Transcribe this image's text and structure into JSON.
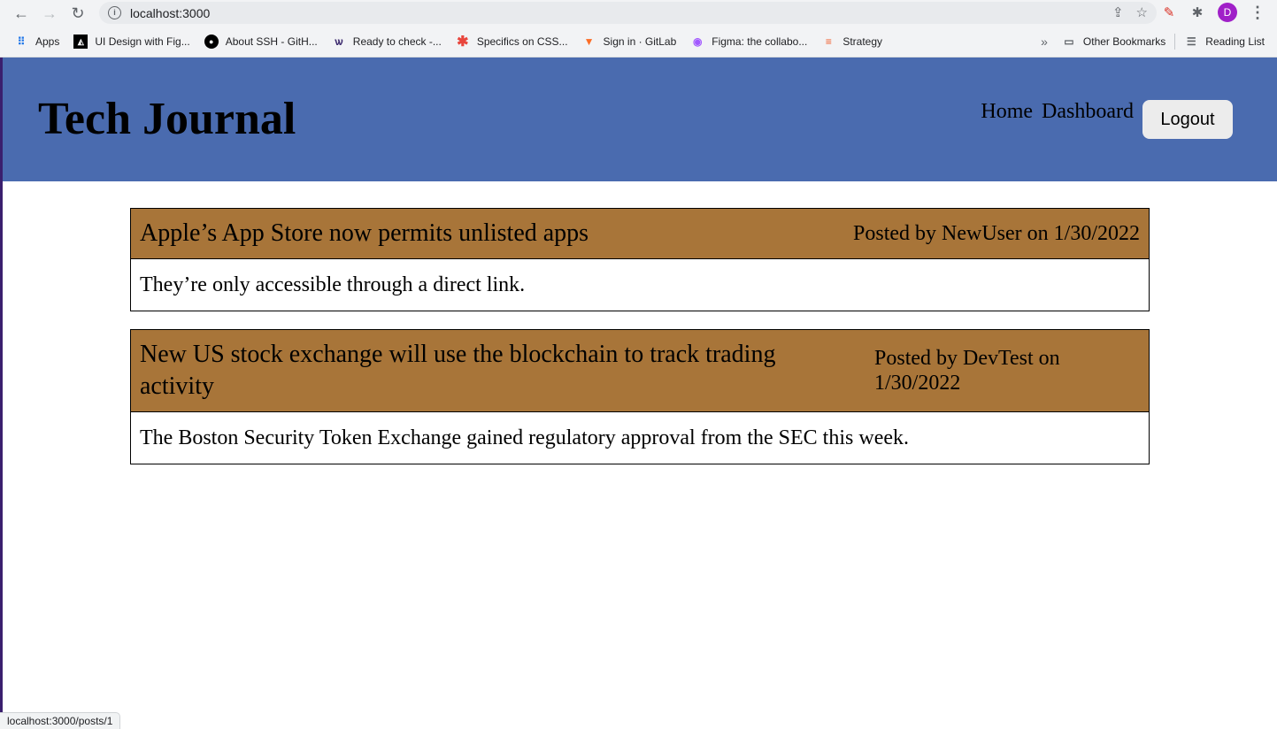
{
  "browser": {
    "url": "localhost:3000",
    "bookmarks": [
      {
        "label": "Apps",
        "icon": "apps-grid-icon"
      },
      {
        "label": "UI Design with Fig...",
        "icon": "course-icon"
      },
      {
        "label": "About SSH - GitH...",
        "icon": "github-icon"
      },
      {
        "label": "Ready to check -...",
        "icon": "wolf-icon"
      },
      {
        "label": "Specifics on CSS...",
        "icon": "asterisk-icon"
      },
      {
        "label": "Sign in · GitLab",
        "icon": "gitlab-icon"
      },
      {
        "label": "Figma: the collabo...",
        "icon": "figma-icon"
      },
      {
        "label": "Strategy",
        "icon": "strategy-icon"
      }
    ],
    "other_bookmarks": "Other Bookmarks",
    "reading_list": "Reading List",
    "avatar_letter": "D",
    "status_url": "localhost:3000/posts/1"
  },
  "header": {
    "title": "Tech Journal",
    "nav": {
      "home": "Home",
      "dashboard": "Dashboard",
      "logout": "Logout"
    },
    "color": "#4a6baf"
  },
  "posts": [
    {
      "title": "Apple’s App Store now permits unlisted apps",
      "meta": "Posted by NewUser on 1/30/2022",
      "body": "They’re only accessible through a direct link."
    },
    {
      "title": "New US stock exchange will use the blockchain to track trading activity",
      "meta": "Posted by DevTest on 1/30/2022",
      "body": "The Boston Security Token Exchange gained regulatory approval from the SEC this week."
    }
  ],
  "post_header_color": "#a87539"
}
